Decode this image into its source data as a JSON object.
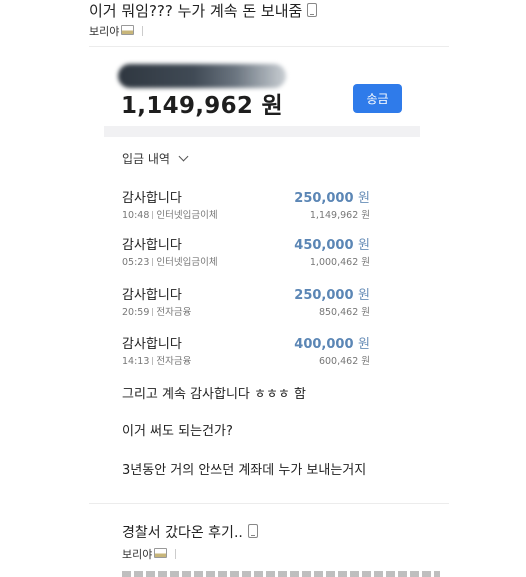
{
  "post1": {
    "title": "이거 뭐임??? 누가 계속 돈 보내줌",
    "author": "보리야"
  },
  "account": {
    "balance": "1,149,962 원",
    "transfer_label": "송금"
  },
  "history": {
    "label": "입금 내역",
    "transactions": [
      {
        "name": "감사합니다",
        "amount": "250,000",
        "currency": "원",
        "time": "10:48",
        "type": "인터넷입금이체",
        "balance_after": "1,149,962 원"
      },
      {
        "name": "감사합니다",
        "amount": "450,000",
        "currency": "원",
        "time": "05:23",
        "type": "인터넷입금이체",
        "balance_after": "1,000,462 원"
      },
      {
        "name": "감사합니다",
        "amount": "250,000",
        "currency": "원",
        "time": "20:59",
        "type": "전자금융",
        "balance_after": "850,462 원"
      },
      {
        "name": "감사합니다",
        "amount": "400,000",
        "currency": "원",
        "time": "14:13",
        "type": "전자금융",
        "balance_after": "600,462 원"
      }
    ]
  },
  "body_lines": [
    "그리고 계속 감사합니다 ㅎㅎㅎ 함",
    "이거 써도 되는건가?",
    "3년동안 거의 안쓰던 계좌데 누가 보내는거지"
  ],
  "post2": {
    "title": "경찰서 갔다온 후기..",
    "author": "보리야"
  },
  "colors": {
    "accent_button": "#2f7bea",
    "amount_text": "#5b86b5"
  },
  "icons": {
    "title_icon": "mobile-phone-icon",
    "author_icon": "image-attachment-icon"
  }
}
